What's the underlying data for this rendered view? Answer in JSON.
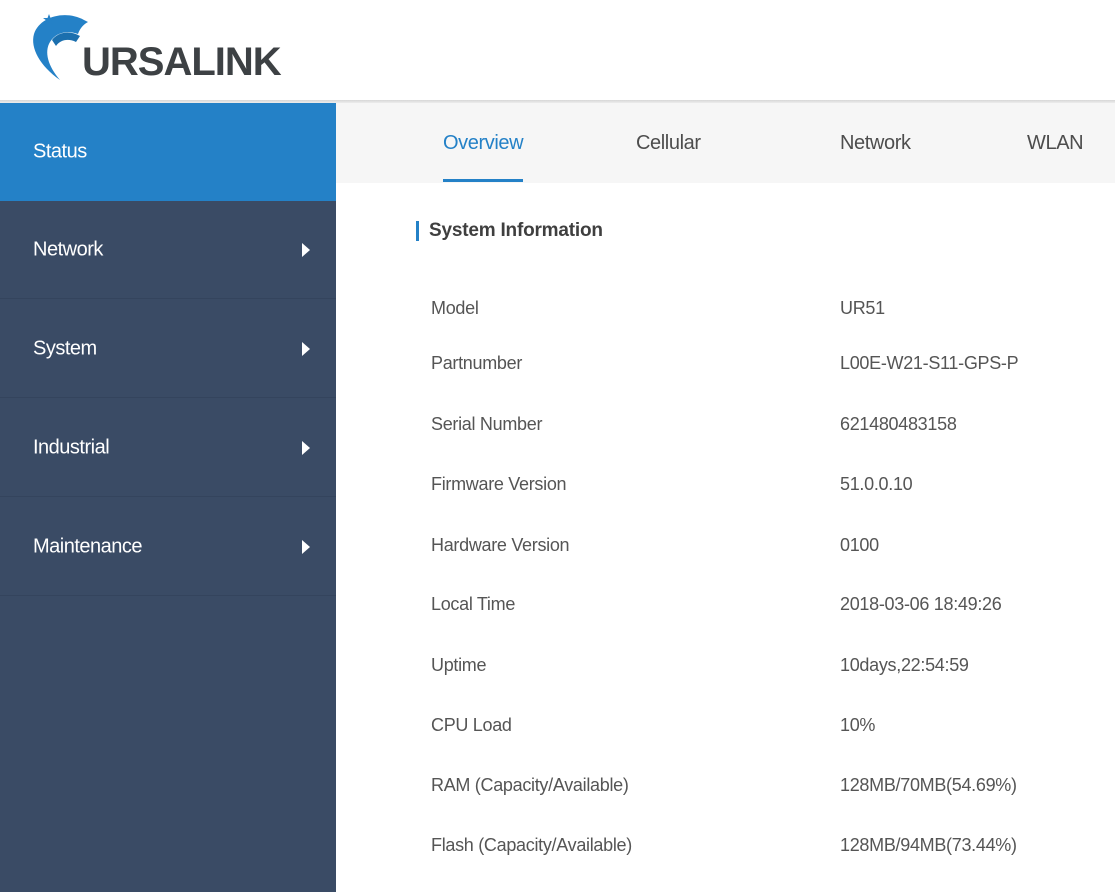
{
  "header": {
    "logo_text": "URSALINK"
  },
  "sidebar": {
    "items": [
      {
        "label": "Status",
        "active": true,
        "has_arrow": false
      },
      {
        "label": "Network",
        "active": false,
        "has_arrow": true
      },
      {
        "label": "System",
        "active": false,
        "has_arrow": true
      },
      {
        "label": "Industrial",
        "active": false,
        "has_arrow": true
      },
      {
        "label": "Maintenance",
        "active": false,
        "has_arrow": true
      }
    ]
  },
  "tabs": [
    {
      "label": "Overview",
      "active": true
    },
    {
      "label": "Cellular",
      "active": false
    },
    {
      "label": "Network",
      "active": false
    },
    {
      "label": "WLAN",
      "active": false
    }
  ],
  "system_info": {
    "title": "System Information",
    "rows": [
      {
        "label": "Model",
        "value": "UR51"
      },
      {
        "label": "Partnumber",
        "value": "L00E-W21-S11-GPS-P"
      },
      {
        "label": "Serial Number",
        "value": "621480483158"
      },
      {
        "label": "Firmware Version",
        "value": "51.0.0.10"
      },
      {
        "label": "Hardware Version",
        "value": "0100"
      },
      {
        "label": "Local Time",
        "value": "2018-03-06 18:49:26"
      },
      {
        "label": "Uptime",
        "value": "10days,22:54:59"
      },
      {
        "label": "CPU Load",
        "value": "10%"
      },
      {
        "label": "RAM (Capacity/Available)",
        "value": "128MB/70MB(54.69%)"
      },
      {
        "label": "Flash (Capacity/Available)",
        "value": "128MB/94MB(73.44%)"
      }
    ]
  },
  "colors": {
    "accent": "#2481c7",
    "sidebar_bg": "#3a4b65",
    "tab_bar_bg": "#f6f6f6"
  },
  "icons": [
    "ursalink-logo",
    "chevron-right-icon"
  ]
}
